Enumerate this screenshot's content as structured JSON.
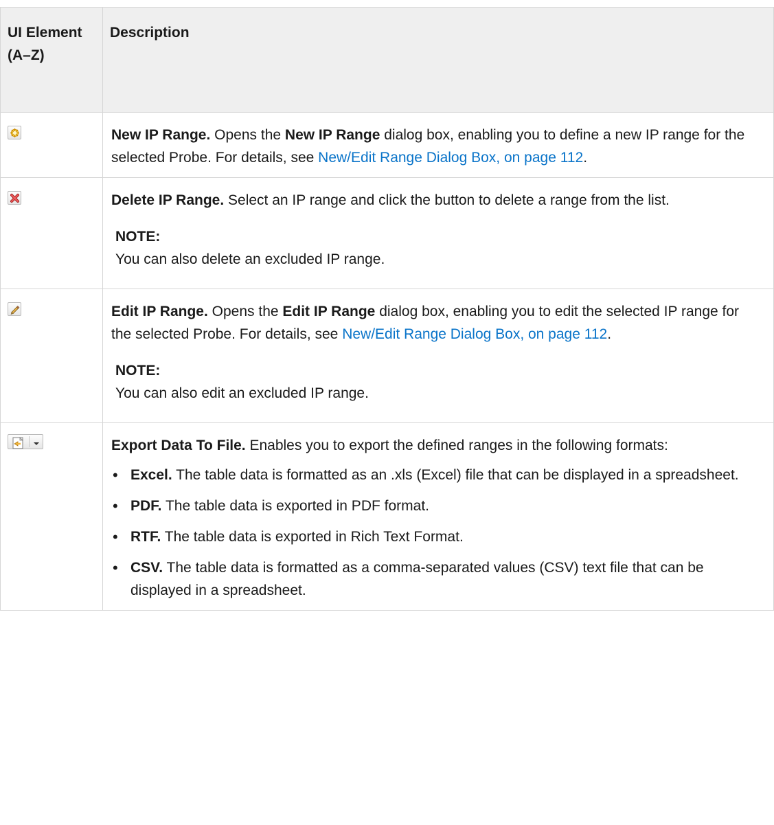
{
  "table": {
    "headers": {
      "element": "UI Element (A–Z)",
      "description": "Description"
    },
    "rows": {
      "new_range": {
        "icon": "new-star-icon",
        "title": "New IP Range.",
        "t1": " Opens the ",
        "bold1": "New IP Range",
        "t2": " dialog box, enabling you to define a new IP range for the selected Probe. For details, see ",
        "link": "New/Edit Range Dialog Box, on page 112",
        "t3": "."
      },
      "delete_range": {
        "icon": "delete-x-icon",
        "title": "Delete IP Range.",
        "t1": " Select an IP range and click the button to delete a range from the list.",
        "note_title": "NOTE:",
        "note_text": "You can also delete an excluded IP range."
      },
      "edit_range": {
        "icon": "edit-pencil-icon",
        "title": "Edit IP Range.",
        "t1": " Opens the ",
        "bold1": "Edit IP Range",
        "t2": " dialog box, enabling you to edit the selected IP range for the selected Probe. For details, see ",
        "link": "New/Edit Range Dialog Box, on page 112",
        "t3": ".",
        "note_title": "NOTE:",
        "note_text": "You can also edit an excluded IP range."
      },
      "export": {
        "icon": "export-file-icon",
        "title": "Export Data To File.",
        "t1": " Enables you to export the defined ranges in the following formats:",
        "items": [
          {
            "label": "Excel.",
            "text": " The table data is formatted as an .xls (Excel) file that can be displayed in a spreadsheet."
          },
          {
            "label": "PDF.",
            "text": " The table data is exported in PDF format."
          },
          {
            "label": "RTF.",
            "text": " The table data is exported in Rich Text Format."
          },
          {
            "label": "CSV.",
            "text": " The table data is formatted as a comma-separated values (CSV) text file that can be displayed in a spreadsheet."
          }
        ]
      }
    }
  },
  "colors": {
    "link": "#0a74c9",
    "header_bg": "#efefef",
    "border": "#d6d6d6"
  }
}
